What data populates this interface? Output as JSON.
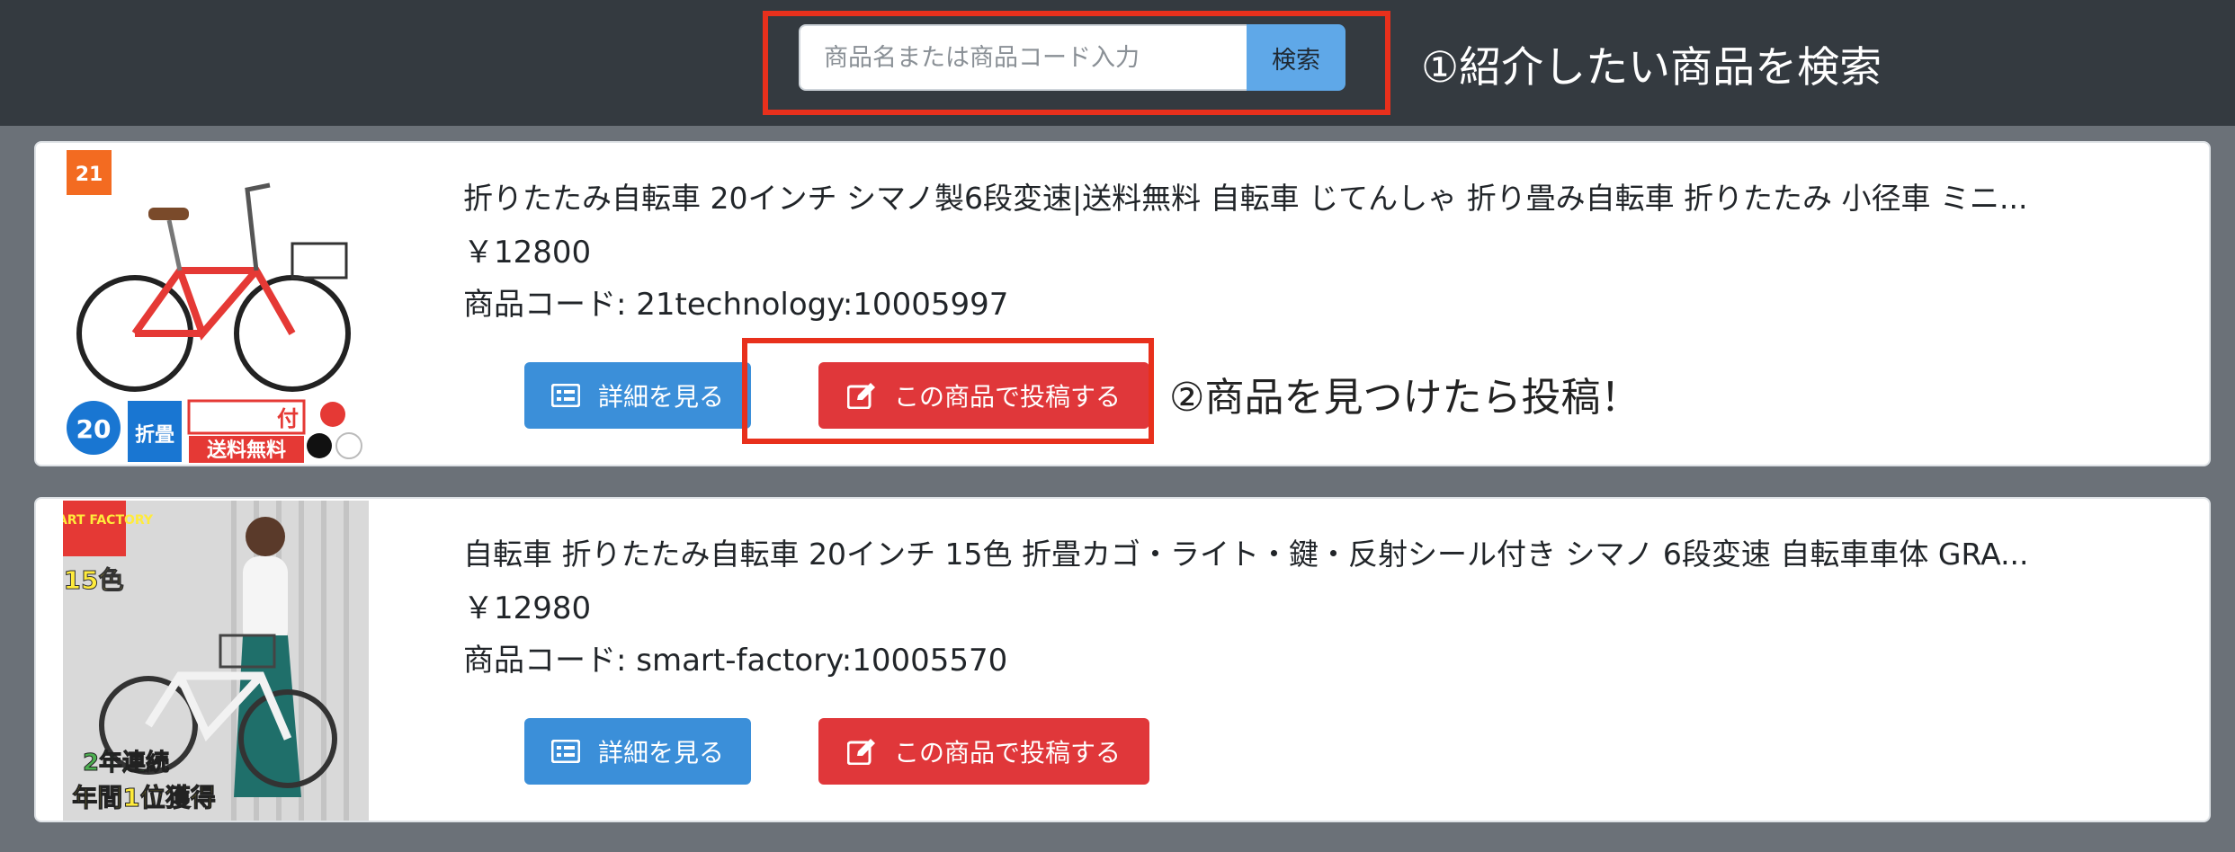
{
  "search": {
    "placeholder": "商品名または商品コード入力",
    "button_label": "検索"
  },
  "annotations": {
    "search_note": "①紹介したい商品を検索",
    "post_note": "②商品を見つけたら投稿！"
  },
  "products": [
    {
      "title": "折りたたみ自転車 20インチ シマノ製6段変速|送料無料 自転車 じてんしゃ 折り畳み自転車 折りたたみ 小径車 ミニ...",
      "price": "￥12800",
      "code": "商品コード: 21technology:10005997",
      "detail_label": "詳細を見る",
      "post_label": "この商品で投稿する",
      "image_badges": [
        "21",
        "20",
        "折畳",
        "付",
        "送料無料"
      ]
    },
    {
      "title": "自転車 折りたたみ自転車 20インチ 15色 折畳カゴ・ライト・鍵・反射シール付き シマノ 6段変速 自転車車体 GRA...",
      "price": "￥12980",
      "code": "商品コード: smart-factory:10005570",
      "detail_label": "詳細を見る",
      "post_label": "この商品で投稿する",
      "image_badges": [
        "SMART FACTORY",
        "15色",
        "2年連続",
        "年間1位獲得"
      ]
    }
  ],
  "colors": {
    "topbar": "#343a40",
    "background": "#6b7178",
    "detail_button": "#3b8fd9",
    "post_button": "#e0373a",
    "annotation": "#e8301c"
  }
}
